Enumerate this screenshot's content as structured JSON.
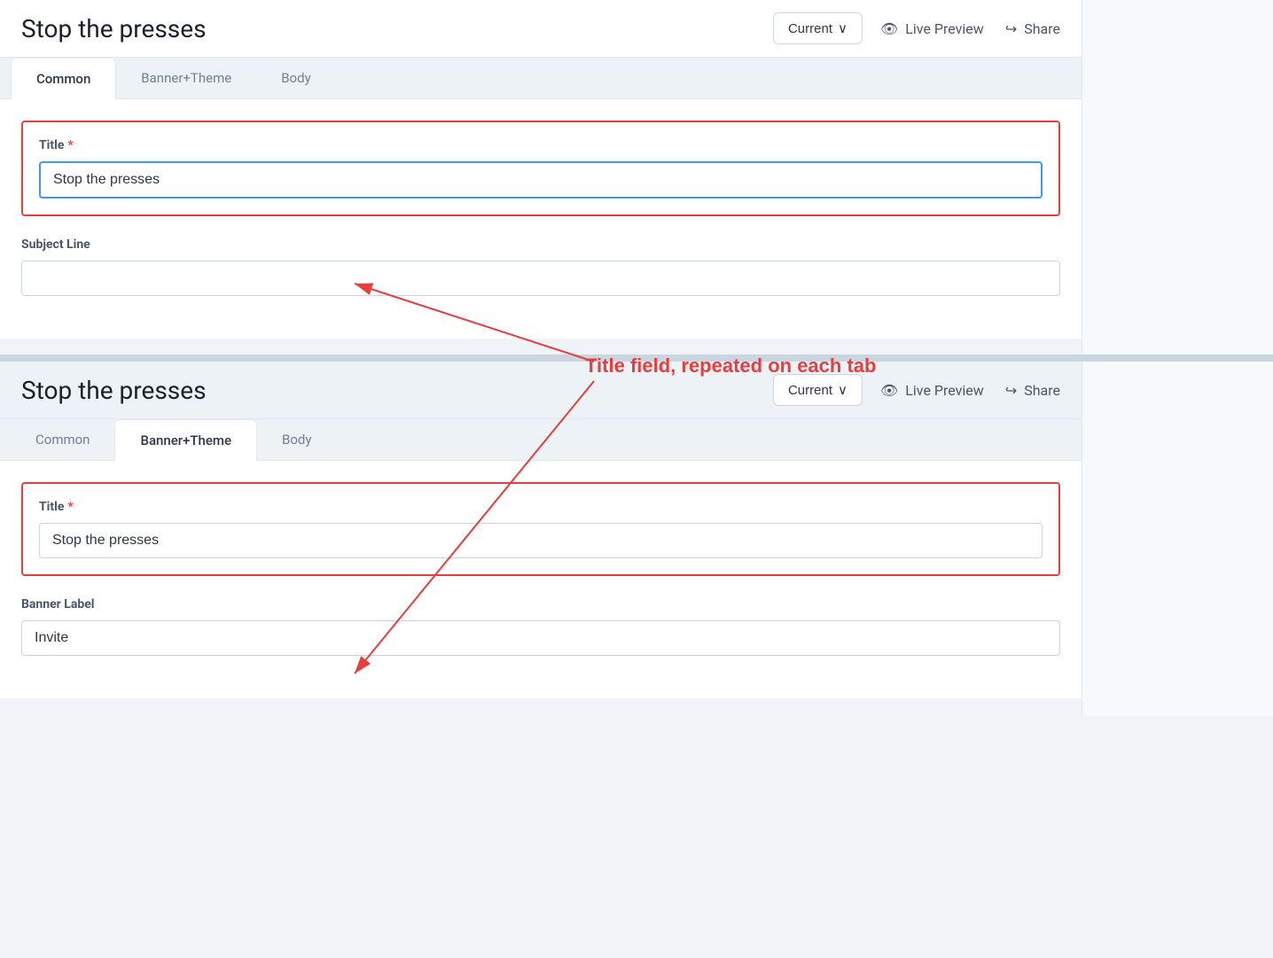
{
  "app": {
    "title": "Stop the presses"
  },
  "header": {
    "title": "Stop the presses",
    "current_label": "Current",
    "live_preview_label": "Live Preview",
    "share_label": "Share"
  },
  "tabs_panel1": {
    "items": [
      {
        "label": "Common",
        "active": true
      },
      {
        "label": "Banner+Theme",
        "active": false
      },
      {
        "label": "Body",
        "active": false
      }
    ]
  },
  "tabs_panel2": {
    "items": [
      {
        "label": "Common",
        "active": false
      },
      {
        "label": "Banner+Theme",
        "active": true
      },
      {
        "label": "Body",
        "active": false
      }
    ]
  },
  "panel1": {
    "title_label": "Title",
    "title_value": "Stop the presses",
    "subject_line_label": "Subject Line",
    "subject_line_placeholder": ""
  },
  "panel2": {
    "title_label": "Title",
    "title_value": "Stop the presses",
    "banner_label_label": "Banner Label",
    "banner_label_value": "Invite"
  },
  "annotation": {
    "text": "Title field, repeated on each tab"
  },
  "icons": {
    "eye": "👁",
    "share": "↪",
    "chevron_down": "∨"
  }
}
